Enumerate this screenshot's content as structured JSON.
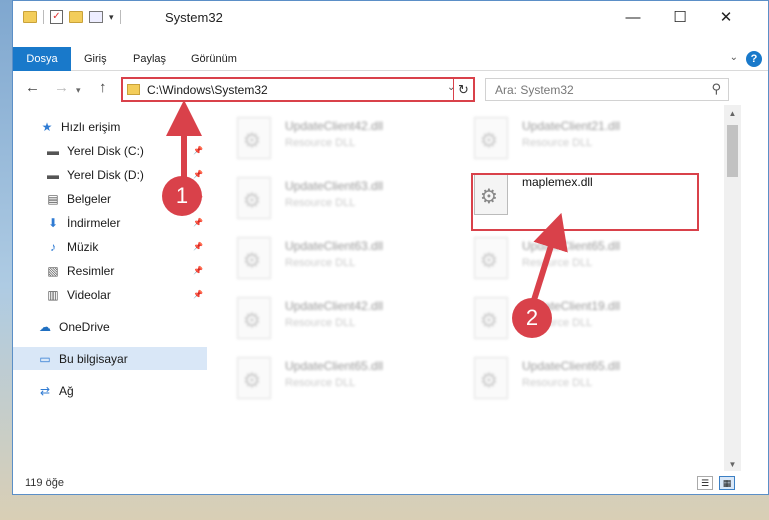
{
  "window": {
    "title": "System32",
    "controls": {
      "minimize": "—",
      "maximize": "☐",
      "close": "✕"
    }
  },
  "ribbon": {
    "tabs": [
      "Dosya",
      "Giriş",
      "Paylaş",
      "Görünüm"
    ],
    "help": "?"
  },
  "address": {
    "path": "C:\\Windows\\System32",
    "search_placeholder": "Ara: System32"
  },
  "sidebar": {
    "items": [
      {
        "label": "Hızlı erişim",
        "icon": "star-icon",
        "pinned": false
      },
      {
        "label": "Yerel Disk (C:)",
        "icon": "drive-icon",
        "pinned": true
      },
      {
        "label": "Yerel Disk (D:)",
        "icon": "drive-icon",
        "pinned": true
      },
      {
        "label": "Belgeler",
        "icon": "documents-icon",
        "pinned": true
      },
      {
        "label": "İndirmeler",
        "icon": "download-icon",
        "pinned": true
      },
      {
        "label": "Müzik",
        "icon": "music-icon",
        "pinned": true
      },
      {
        "label": "Resimler",
        "icon": "pictures-icon",
        "pinned": true
      },
      {
        "label": "Videolar",
        "icon": "video-icon",
        "pinned": true
      },
      {
        "label": "OneDrive",
        "icon": "cloud-icon",
        "pinned": false
      },
      {
        "label": "Bu bilgisayar",
        "icon": "computer-icon",
        "pinned": false,
        "selected": true
      },
      {
        "label": "Ağ",
        "icon": "network-icon",
        "pinned": false
      }
    ]
  },
  "files": [
    {
      "name": "UpdateClient42.dll",
      "type": "Resource DLL",
      "blurred": true
    },
    {
      "name": "UpdateClient21.dll",
      "type": "Resource DLL",
      "blurred": true
    },
    {
      "name": "UpdateClient63.dll",
      "type": "Resource DLL",
      "blurred": true
    },
    {
      "name": "maplemex.dll",
      "type": "",
      "blurred": false
    },
    {
      "name": "UpdateClient63.dll",
      "type": "Resource DLL",
      "blurred": true
    },
    {
      "name": "UpdateClient65.dll",
      "type": "Resource DLL",
      "blurred": true
    },
    {
      "name": "UpdateClient42.dll",
      "type": "Resource DLL",
      "blurred": true
    },
    {
      "name": "UpdateClient19.dll",
      "type": "Resource DLL",
      "blurred": true
    },
    {
      "name": "UpdateClient65.dll",
      "type": "Resource DLL",
      "blurred": true
    },
    {
      "name": "UpdateClient65.dll",
      "type": "Resource DLL",
      "blurred": true
    }
  ],
  "status": {
    "count": "119 öğe"
  },
  "annotations": {
    "step1": "1",
    "step2": "2",
    "color": "#d9414a"
  }
}
